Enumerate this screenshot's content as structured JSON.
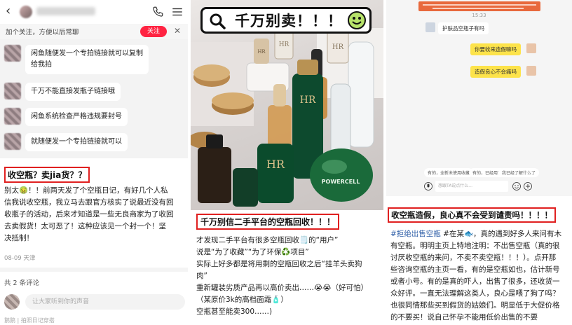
{
  "panel1": {
    "follow_text": "加个关注，方便以后常聊",
    "follow_button": "关注",
    "close_glyph": "✕",
    "messages": [
      "闲鱼随便发一个专拍链接就可以复制",
      "给我拍",
      "千万不能直接发瓶子链接哦",
      "闲鱼系统检查严格违规要封号",
      "就随便发一个专拍链接就可以"
    ],
    "title": "收空瓶？卖jia货？？",
    "body_lines": [
      "别太🤢！！前两天发了个空瓶日记，有好几个人私",
      "信我说收空瓶，我立马去跟官方核实了说最近没有回",
      "收瓶子的活动，后来才知道是一些无良商家为了收回",
      "去卖假货！太可恶了！这种应该见一个封一个！坚",
      "决抵制！"
    ],
    "meta": "08-09 天津",
    "comment_count": "共 2 条评论",
    "comment_placeholder": "让大家听到你的声音",
    "bottom_text": "鹅鹅 | 拍照日记穿搭"
  },
  "panel2": {
    "banner": "千万别卖！！！",
    "title": "千万别信二手平台的空瓶回收！！！",
    "body_lines": [
      "才发现二手平台有很多空瓶回收🗒️的“用户”",
      "说是“为了收藏”“为了环保♻️项目”",
      "实际上好多都是将用剩的空瓶回收之后“挂羊头卖狗",
      "肉”",
      "重新罐装劣质产品再以高价卖出……😭😭（好可怕）",
      "（某原价3k的高档面霜🧴）",
      "空瓶甚至能卖300……)"
    ],
    "bottle_brands": [
      "HR",
      "HR",
      "HR",
      "HR",
      "HR",
      "POWERCELL"
    ]
  },
  "panel3": {
    "time": "15:33",
    "messages": [
      {
        "side": "left",
        "text": "护肤品空瓶子有吗"
      },
      {
        "side": "right",
        "text": "你要收来造假嘛吗"
      },
      {
        "side": "right",
        "text": "造假良心不会痛吗"
      }
    ],
    "quick_replies": [
      "有的，全新未使用收藏",
      "有的，已经用了",
      "我已经了解什么了"
    ],
    "input_placeholder": "想跟TA说点什么...",
    "title": "收空瓶造假，良心真不会受到谴责吗！！！！",
    "body_lines": [
      {
        "tag": "#拒绝出售空瓶",
        "text": " #在某🐟，真的遇到好多人来问有木"
      },
      {
        "tag": "",
        "text": "有空瓶。明明主页上特地注明：不出售空瓶（真的很"
      },
      {
        "tag": "",
        "text": "讨厌收空瓶的来问，不卖不卖空瓶！！！）。点开那"
      },
      {
        "tag": "",
        "text": "些咨询空瓶的主页一看，有的是空瓶如也，估计新号"
      },
      {
        "tag": "",
        "text": "或者小号。有的是真的吓人，出售了很多，还收货一"
      },
      {
        "tag": "",
        "text": "众好评。一直无法理解这类人，良心是喂了狗了吗？"
      },
      {
        "tag": "",
        "text": "也很同情那些买到假货的姑娘们。明显低于大促价格"
      },
      {
        "tag": "",
        "text": "的不要买！说自己怀孕不能用低价出售的不要"
      }
    ]
  }
}
